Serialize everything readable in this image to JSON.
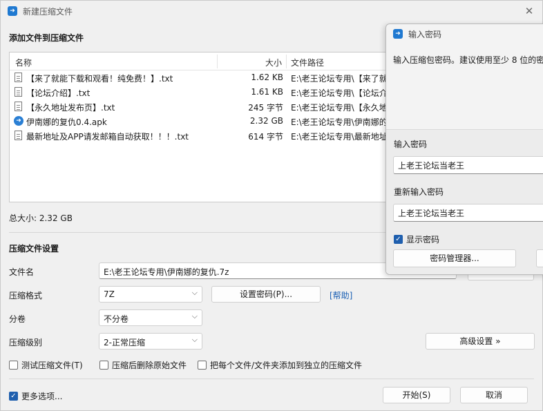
{
  "window": {
    "title": "新建压缩文件",
    "close_glyph": "✕"
  },
  "files_section": {
    "title": "添加文件到压缩文件",
    "columns": {
      "name": "名称",
      "size": "大小",
      "path": "文件路径"
    },
    "rows": [
      {
        "icon": "document-icon",
        "name": "【来了就能下载和观看！纯免费！】.txt",
        "size": "1.62 KB",
        "path": "E:\\老王论坛专用\\【来了就"
      },
      {
        "icon": "document-icon",
        "name": "【论坛介绍】.txt",
        "size": "1.61 KB",
        "path": "E:\\老王论坛专用\\【论坛介"
      },
      {
        "icon": "document-icon",
        "name": "【永久地址发布页】.txt",
        "size": "245 字节",
        "path": "E:\\老王论坛专用\\【永久地"
      },
      {
        "icon": "apk-icon",
        "name": "伊南娜的复仇0.4.apk",
        "size": "2.32 GB",
        "path": "E:\\老王论坛专用\\伊南娜的"
      },
      {
        "icon": "document-icon",
        "name": "最新地址及APP请发邮箱自动获取！！！.txt",
        "size": "614 字节",
        "path": "E:\\老王论坛专用\\最新地址"
      }
    ],
    "total": "总大小: 2.32 GB"
  },
  "settings": {
    "title": "压缩文件设置",
    "filename_label": "文件名",
    "filename_value": "E:\\老王论坛专用\\伊南娜的复仇.7z",
    "format_label": "压缩格式",
    "format_value": "7Z",
    "set_password_button": "设置密码(P)...",
    "help_link": "[帮助]",
    "volume_label": "分卷",
    "volume_value": "不分卷",
    "level_label": "压缩级别",
    "level_value": "2-正常压缩",
    "advanced_button": "高级设置 »",
    "test_checkbox": "测试压缩文件(T)",
    "delete_checkbox": "压缩后删除原始文件",
    "separate_checkbox": "把每个文件/文件夹添加到独立的压缩文件",
    "more_options": "更多选项...",
    "start_button": "开始(S)",
    "cancel_button": "取消"
  },
  "password_dialog": {
    "title": "输入密码",
    "hint": "输入压缩包密码。建议使用至少 8 位的密",
    "password_label": "输入密码",
    "password_value": "上老王论坛当老王",
    "confirm_label": "重新输入密码",
    "confirm_value": "上老王论坛当老王",
    "show_password": "显示密码",
    "manager_button": "密码管理器..."
  },
  "colors": {
    "accent": "#1f5fae",
    "app_icon": "#1f79d1",
    "link": "#1a5fb4"
  }
}
